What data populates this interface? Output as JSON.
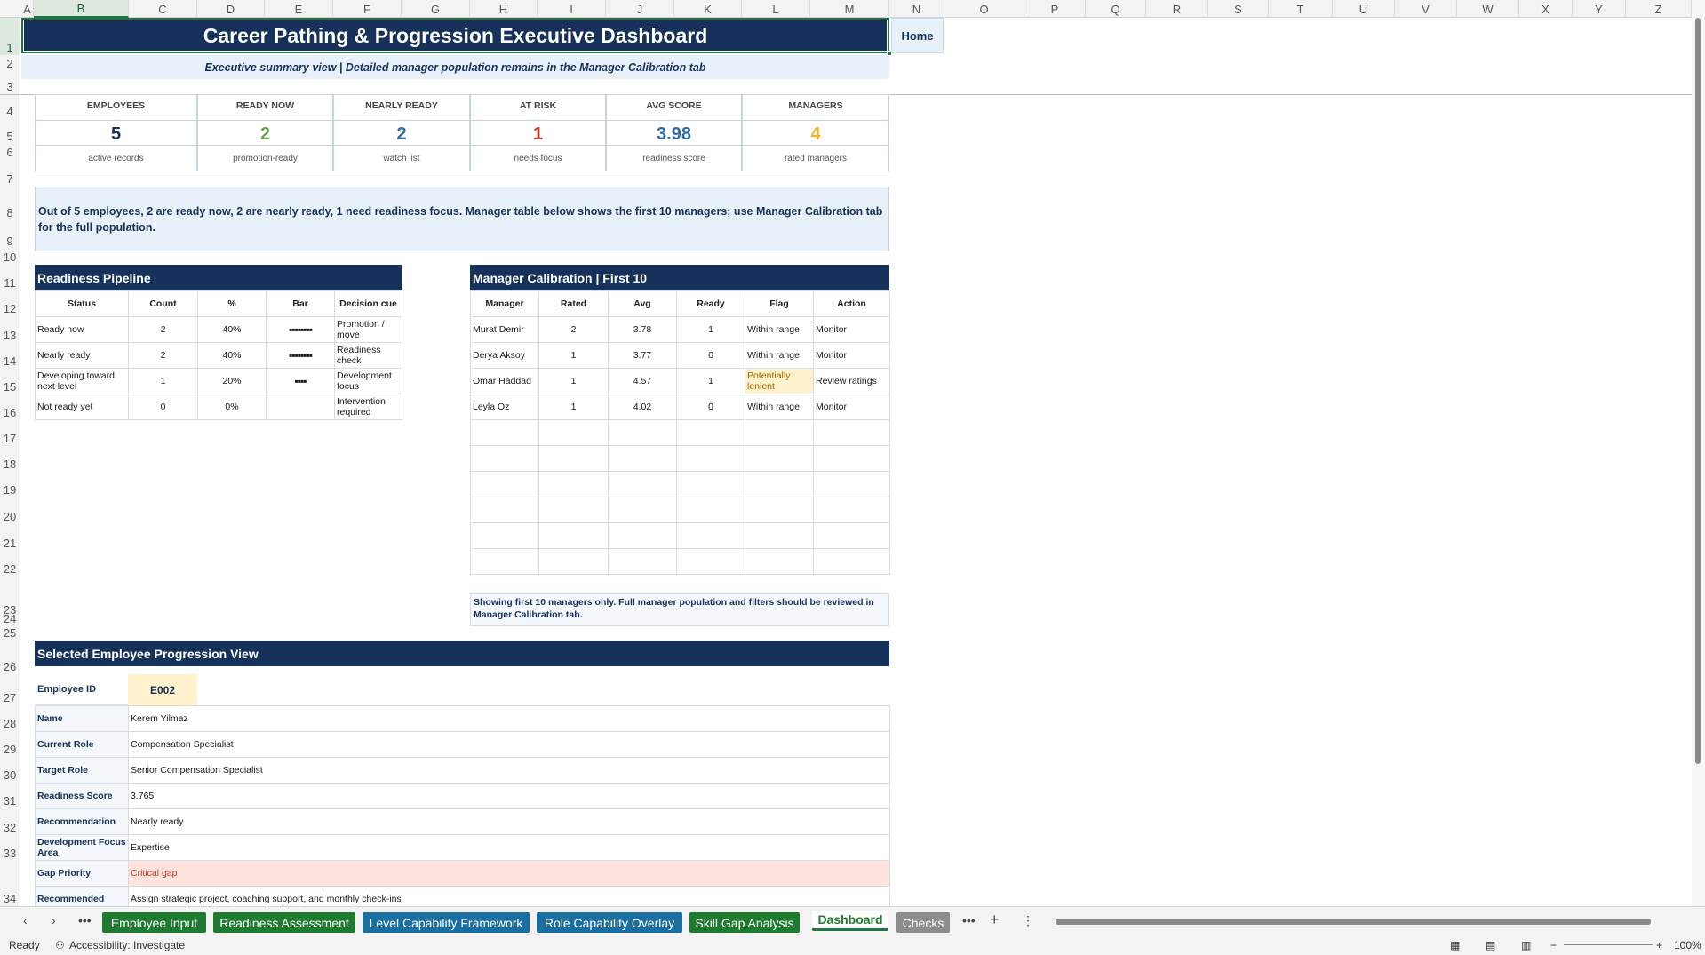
{
  "columns": [
    "A",
    "B",
    "C",
    "D",
    "E",
    "F",
    "G",
    "H",
    "I",
    "J",
    "K",
    "L",
    "M",
    "N",
    "O",
    "P",
    "Q",
    "R",
    "S",
    "T",
    "U",
    "V",
    "W",
    "X",
    "Y",
    "Z"
  ],
  "rows": [
    "1",
    "2",
    "3",
    "4",
    "5",
    "6",
    "7",
    "8",
    "9",
    "10",
    "11",
    "12",
    "13",
    "14",
    "15",
    "16",
    "17",
    "18",
    "19",
    "20",
    "21",
    "22",
    "23",
    "24",
    "25",
    "26",
    "27",
    "28",
    "29",
    "30",
    "31",
    "32",
    "33",
    "34"
  ],
  "title": "Career Pathing & Progression Executive Dashboard",
  "home_label": "Home",
  "subtitle": "Executive summary view | Detailed manager population remains in the Manager Calibration tab",
  "kpis": [
    {
      "label": "EMPLOYEES",
      "value": "5",
      "caption": "active records",
      "color": "#17325a"
    },
    {
      "label": "READY NOW",
      "value": "2",
      "caption": "promotion-ready",
      "color": "#6aa84f"
    },
    {
      "label": "NEARLY READY",
      "value": "2",
      "caption": "watch list",
      "color": "#2e6da4"
    },
    {
      "label": "AT RISK",
      "value": "1",
      "caption": "needs focus",
      "color": "#c0392b"
    },
    {
      "label": "AVG SCORE",
      "value": "3.98",
      "caption": "readiness score",
      "color": "#2e6da4"
    },
    {
      "label": "MANAGERS",
      "value": "4",
      "caption": "rated managers",
      "color": "#f1b02a"
    }
  ],
  "summary": "Out of 5 employees, 2 are ready now, 2 are nearly ready, 1 need readiness focus. Manager table below shows the first 10 managers; use Manager Calibration tab for the full population.",
  "pipeline": {
    "title": "Readiness Pipeline",
    "headers": [
      "Status",
      "Count",
      "%",
      "Bar",
      "Decision cue"
    ],
    "rows": [
      {
        "status": "Ready now",
        "count": "2",
        "pct": "40%",
        "bar": "▪▪▪▪▪▪▪▪",
        "cue": "Promotion / move"
      },
      {
        "status": "Nearly ready",
        "count": "2",
        "pct": "40%",
        "bar": "▪▪▪▪▪▪▪▪",
        "cue": "Readiness check"
      },
      {
        "status": "Developing toward next level",
        "count": "1",
        "pct": "20%",
        "bar": "▪▪▪▪",
        "cue": "Development focus"
      },
      {
        "status": "Not ready yet",
        "count": "0",
        "pct": "0%",
        "bar": "",
        "cue": "Intervention required"
      }
    ]
  },
  "calibration": {
    "title": "Manager Calibration | First 10",
    "headers": [
      "Manager",
      "Rated",
      "Avg",
      "Ready",
      "Flag",
      "Action"
    ],
    "rows": [
      {
        "manager": "Murat Demir",
        "rated": "2",
        "avg": "3.78",
        "ready": "1",
        "flag": "Within range",
        "action": "Monitor"
      },
      {
        "manager": "Derya Aksoy",
        "rated": "1",
        "avg": "3.77",
        "ready": "0",
        "flag": "Within range",
        "action": "Monitor"
      },
      {
        "manager": "Omar Haddad",
        "rated": "1",
        "avg": "4.57",
        "ready": "1",
        "flag": "Potentially lenient",
        "action": "Review ratings"
      },
      {
        "manager": "Leyla Oz",
        "rated": "1",
        "avg": "4.02",
        "ready": "0",
        "flag": "Within range",
        "action": "Monitor"
      }
    ],
    "note": "Showing first 10 managers only. Full manager population and filters should be reviewed in Manager Calibration tab."
  },
  "employee": {
    "title": "Selected Employee Progression View",
    "id_label": "Employee ID",
    "id_value": "E002",
    "fields": [
      {
        "key": "Name",
        "value": "Kerem Yilmaz"
      },
      {
        "key": "Current Role",
        "value": "Compensation Specialist"
      },
      {
        "key": "Target Role",
        "value": "Senior Compensation Specialist"
      },
      {
        "key": "Readiness Score",
        "value": "3.765"
      },
      {
        "key": "Recommendation",
        "value": "Nearly ready"
      },
      {
        "key": "Development Focus Area",
        "value": "Expertise"
      },
      {
        "key": "Gap Priority",
        "value": "Critical gap"
      },
      {
        "key": "Recommended",
        "value": "Assign strategic project, coaching support, and monthly check-ins"
      }
    ]
  },
  "tabs": [
    {
      "label": "Employee Input",
      "style": "green"
    },
    {
      "label": "Readiness Assessment",
      "style": "green"
    },
    {
      "label": "Level Capability Framework",
      "style": "teal"
    },
    {
      "label": "Role Capability Overlay",
      "style": "teal"
    },
    {
      "label": "Skill Gap Analysis",
      "style": "green"
    },
    {
      "label": "Dashboard",
      "style": "active"
    },
    {
      "label": "Checks",
      "style": "gray"
    }
  ],
  "status": {
    "ready": "Ready",
    "accessibility": "Accessibility: Investigate",
    "zoom": "100%"
  }
}
